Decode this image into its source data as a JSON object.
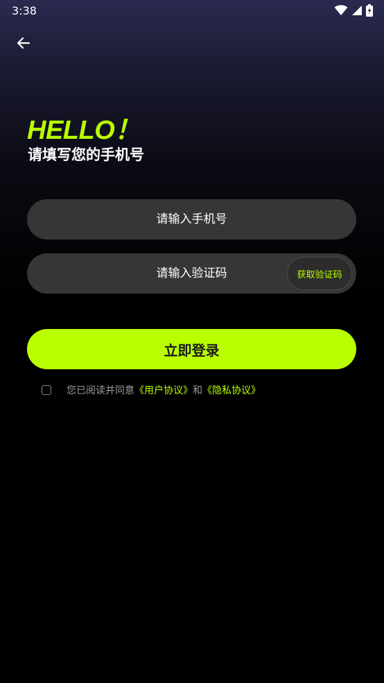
{
  "status_bar": {
    "time": "3:38",
    "icons": [
      "wifi-icon",
      "signal-icon",
      "battery-icon"
    ]
  },
  "header": {
    "back_icon": "arrow-left-icon"
  },
  "greeting": {
    "title": "HELLO！",
    "subtitle": "请填写您的手机号"
  },
  "form": {
    "phone_placeholder": "请输入手机号",
    "phone_value": "",
    "code_placeholder": "请输入验证码",
    "code_value": "",
    "get_code_label": "获取验证码",
    "login_label": "立即登录"
  },
  "agreement": {
    "checked": false,
    "prefix": "您已阅读并同意",
    "user_agreement": "《用户协议》",
    "conjunction": "和",
    "privacy_policy": "《隐私协议》"
  },
  "colors": {
    "accent": "#baff00",
    "background": "#000000",
    "input_bg": "#363636"
  }
}
